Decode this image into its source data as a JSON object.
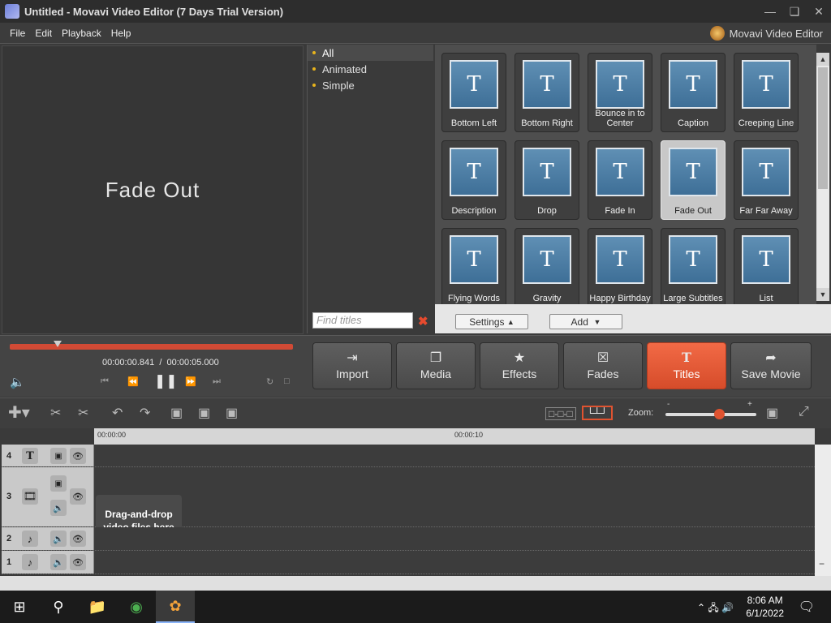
{
  "window": {
    "title": "Untitled - Movavi Video Editor (7 Days Trial Version)"
  },
  "menu": [
    "File",
    "Edit",
    "Playback",
    "Help"
  ],
  "brand": "Movavi Video Editor",
  "preview": {
    "text": "Fade Out"
  },
  "categories": [
    {
      "label": "All",
      "selected": true
    },
    {
      "label": "Animated",
      "selected": false
    },
    {
      "label": "Simple",
      "selected": false
    }
  ],
  "search": {
    "placeholder": "Find titles"
  },
  "titles": [
    "Bottom Left",
    "Bottom Right",
    "Bounce in to Center",
    "Caption",
    "Creeping Line",
    "Description",
    "Drop",
    "Fade In",
    "Fade Out",
    "Far Far Away",
    "Flying Words",
    "Gravity",
    "Happy Birthday",
    "Large Subtitles",
    "List"
  ],
  "selected_title": "Fade Out",
  "gallery_buttons": {
    "settings": "Settings",
    "add": "Add"
  },
  "playback": {
    "current": "00:00:00.841",
    "total": "00:00:05.000"
  },
  "modes": [
    {
      "label": "Import",
      "icon": "import-icon"
    },
    {
      "label": "Media",
      "icon": "media-icon"
    },
    {
      "label": "Effects",
      "icon": "star-icon"
    },
    {
      "label": "Fades",
      "icon": "fades-icon"
    },
    {
      "label": "Titles",
      "icon": "titles-icon",
      "active": true
    },
    {
      "label": "Save Movie",
      "icon": "save-movie-icon"
    }
  ],
  "zoom": {
    "label": "Zoom:",
    "min": "-",
    "max": "+"
  },
  "ruler": {
    "start": "00:00:00",
    "mark": "00:00:10"
  },
  "tracks": [
    {
      "num": "4",
      "type": "text"
    },
    {
      "num": "3",
      "type": "video",
      "placeholder": "Drag-and-drop video files here"
    },
    {
      "num": "2",
      "type": "audio"
    },
    {
      "num": "1",
      "type": "audio"
    }
  ],
  "clock": {
    "time": "8:06 AM",
    "date": "6/1/2022"
  },
  "accent": "#e05330"
}
